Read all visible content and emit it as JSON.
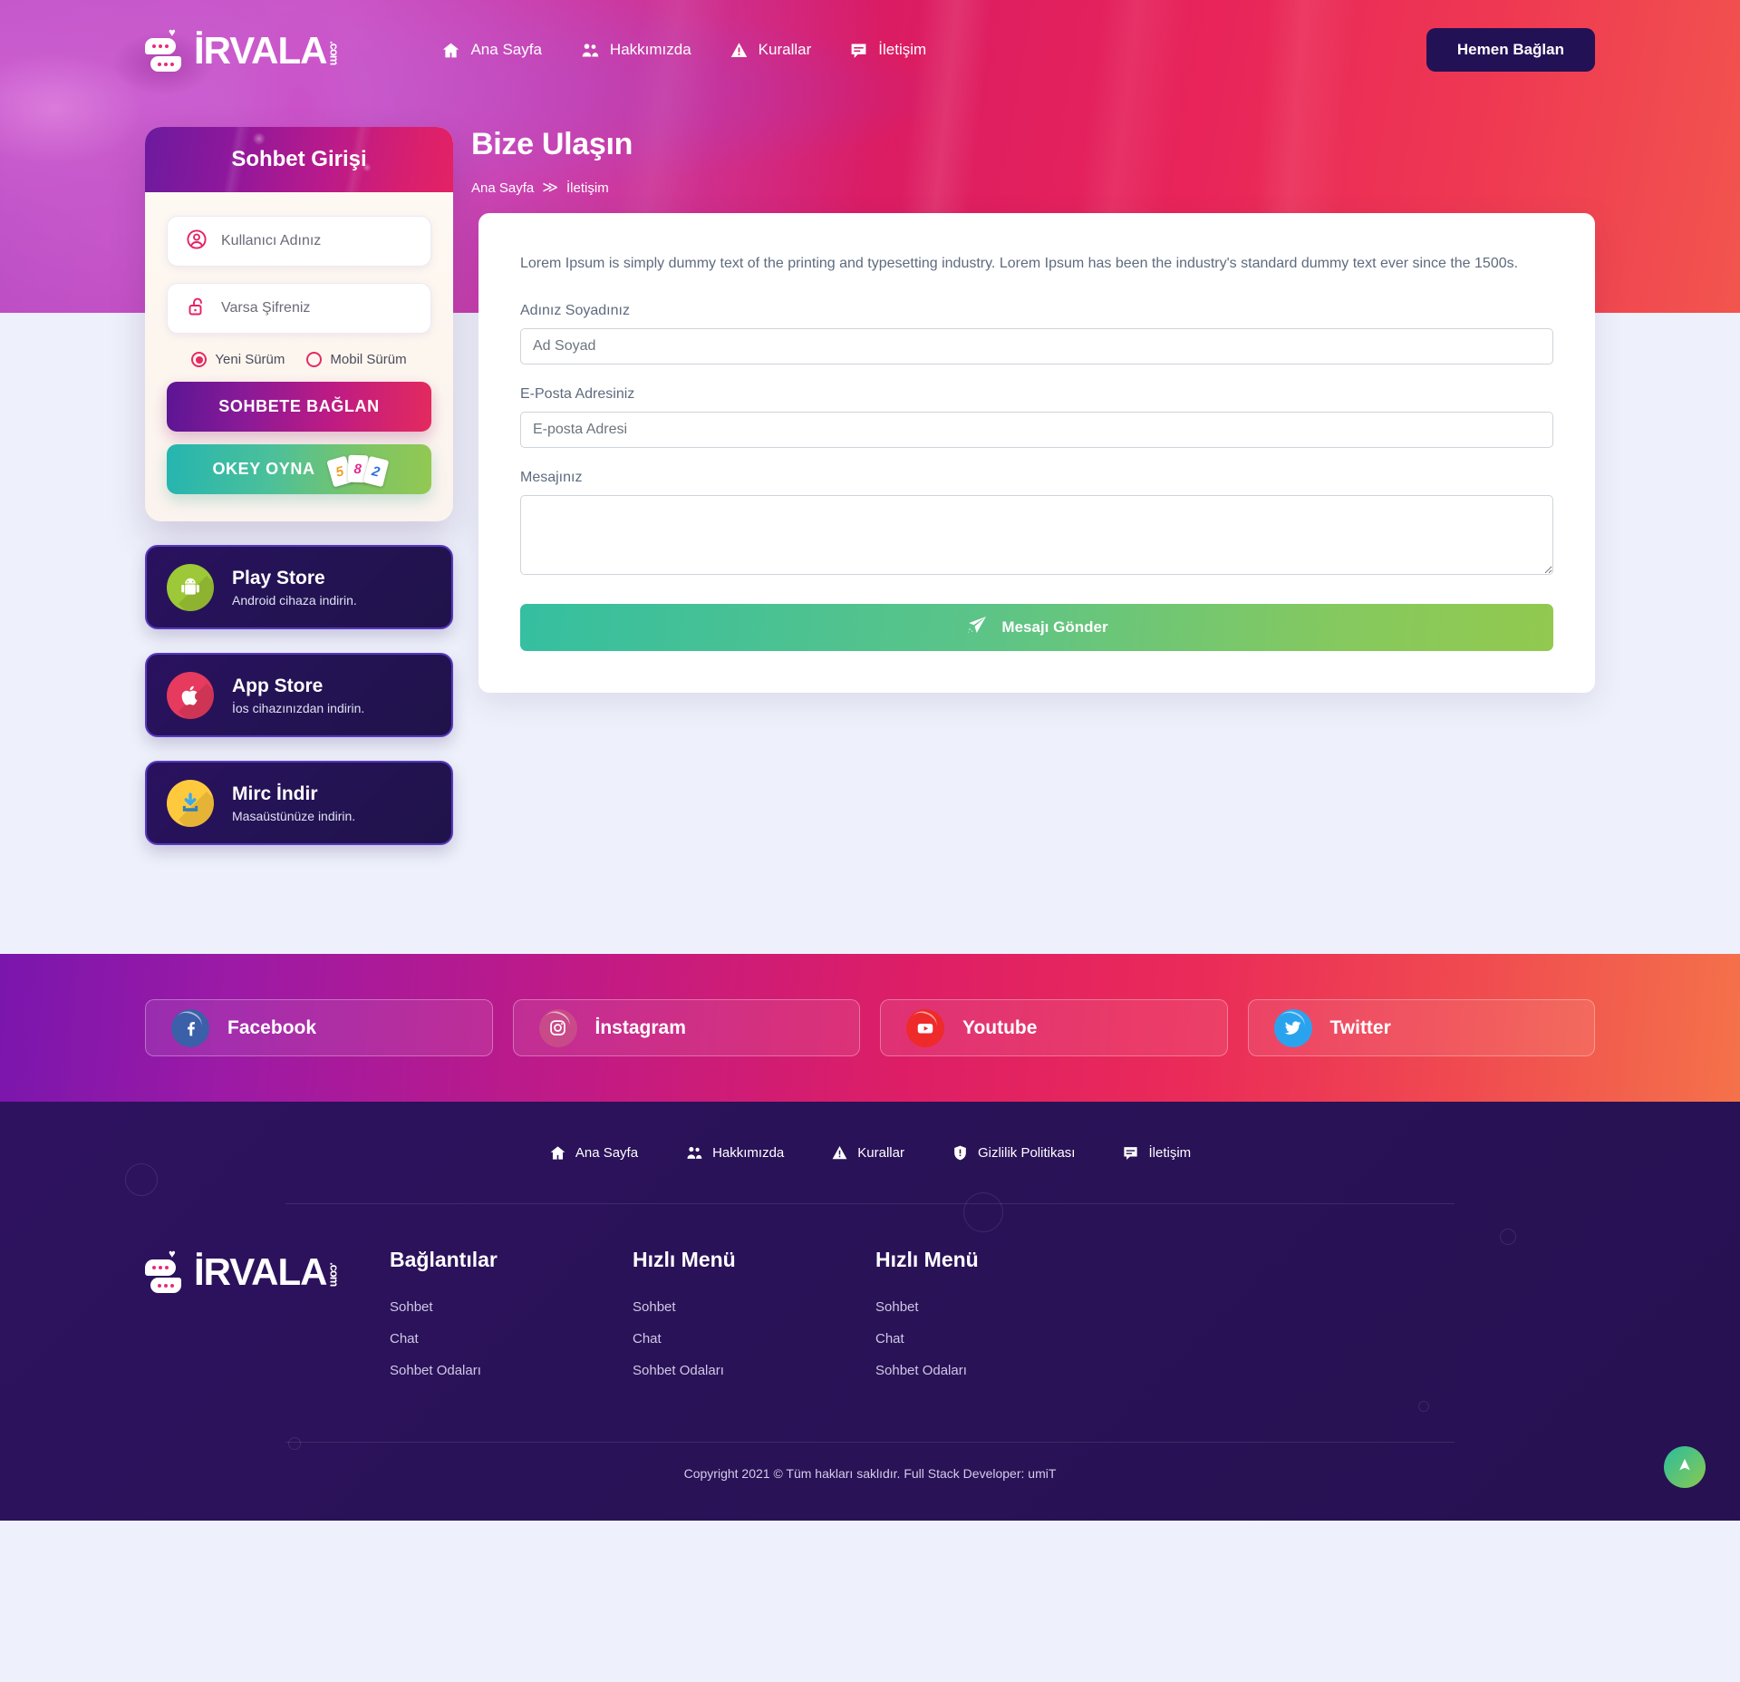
{
  "brand": {
    "name": "İRVALA",
    "suffix": ".com",
    "logo_icon": "chat-bubbles-logo-icon"
  },
  "header": {
    "nav": [
      {
        "label": "Ana Sayfa",
        "icon": "home-icon"
      },
      {
        "label": "Hakkımızda",
        "icon": "people-icon"
      },
      {
        "label": "Kurallar",
        "icon": "warning-triangle-icon"
      },
      {
        "label": "İletişim",
        "icon": "chat-icon"
      }
    ],
    "cta_label": "Hemen Bağlan"
  },
  "hero": {
    "title": "Bize Ulaşın",
    "breadcrumb": {
      "home": "Ana Sayfa",
      "separator": "≫",
      "current": "İletişim"
    }
  },
  "login": {
    "title": "Sohbet Girişi",
    "username_placeholder": "Kullanıcı Adınız",
    "password_placeholder": "Varsa Şifreniz",
    "username_icon": "user-circle-icon",
    "password_icon": "unlock-icon",
    "options": [
      {
        "label": "Yeni Sürüm",
        "selected": true
      },
      {
        "label": "Mobil Sürüm",
        "selected": false
      }
    ],
    "connect_label": "SOHBETE BAĞLAN",
    "okey_label": "OKEY OYNA",
    "okey_tiles": [
      "5",
      "8",
      "2"
    ]
  },
  "stores": [
    {
      "title": "Play Store",
      "subtitle": "Android cihaza indirin.",
      "icon": "android-icon"
    },
    {
      "title": "App Store",
      "subtitle": "İos cihazınızdan indirin.",
      "icon": "apple-icon"
    },
    {
      "title": "Mirc İndir",
      "subtitle": "Masaüstünüze indirin.",
      "icon": "download-icon"
    }
  ],
  "contact": {
    "lead": "Lorem Ipsum is simply dummy text of the printing and typesetting industry. Lorem Ipsum has been the industry's standard dummy text ever since the 1500s.",
    "name_label": "Adınız Soyadınız",
    "name_placeholder": "Ad Soyad",
    "name_value": "",
    "email_label": "E-Posta Adresiniz",
    "email_placeholder": "E-posta Adresi",
    "email_value": "",
    "message_label": "Mesajınız",
    "message_placeholder": "",
    "message_value": "",
    "submit_label": "Mesajı Gönder",
    "submit_icon": "paper-plane-icon"
  },
  "social": [
    {
      "label": "Facebook",
      "icon": "facebook-icon",
      "color": "#3b5fa8"
    },
    {
      "label": "İnstagram",
      "icon": "instagram-icon",
      "color": "#c94a88"
    },
    {
      "label": "Youtube",
      "icon": "youtube-icon",
      "color": "#ef2a2a"
    },
    {
      "label": "Twitter",
      "icon": "twitter-icon",
      "color": "#2aa3ef"
    }
  ],
  "footer": {
    "nav": [
      {
        "label": "Ana Sayfa",
        "icon": "home-icon"
      },
      {
        "label": "Hakkımızda",
        "icon": "people-icon"
      },
      {
        "label": "Kurallar",
        "icon": "warning-triangle-icon"
      },
      {
        "label": "Gizlilik Politikası",
        "icon": "shield-icon"
      },
      {
        "label": "İletişim",
        "icon": "chat-icon"
      }
    ],
    "columns": [
      {
        "title": "Bağlantılar",
        "links": [
          "Sohbet",
          "Chat",
          "Sohbet Odaları"
        ]
      },
      {
        "title": "Hızlı Menü",
        "links": [
          "Sohbet",
          "Chat",
          "Sohbet Odaları"
        ]
      },
      {
        "title": "Hızlı Menü",
        "links": [
          "Sohbet",
          "Chat",
          "Sohbet Odaları"
        ]
      }
    ],
    "copyright": "Copyright 2021 © Tüm hakları saklıdır. Full Stack Developer: umiT",
    "scroll_top_icon": "scroll-to-top-icon"
  },
  "colors": {
    "accent_pink": "#e42264",
    "accent_purple": "#6c1a9e",
    "dark_navy": "#231156",
    "green": "#92c94f"
  }
}
